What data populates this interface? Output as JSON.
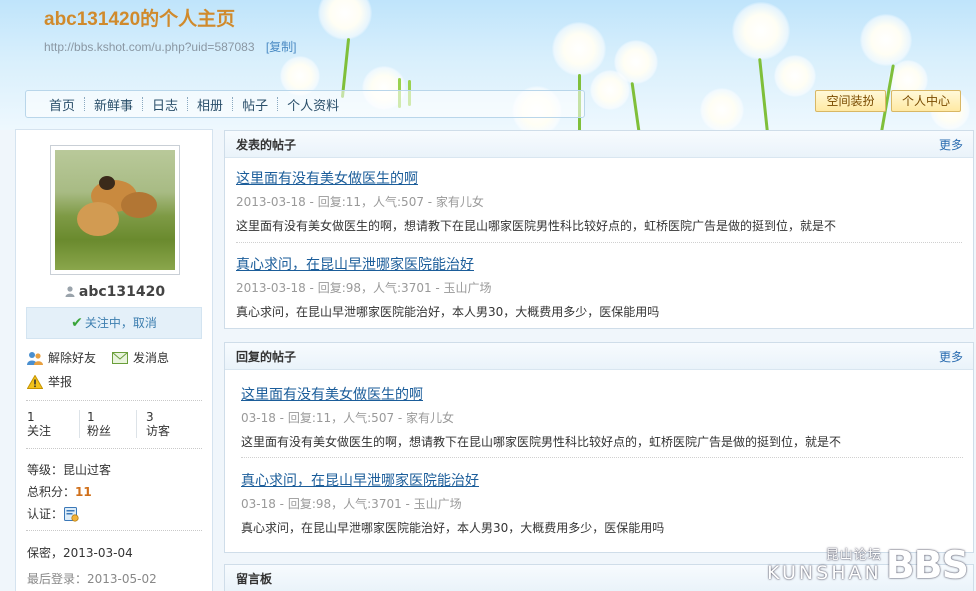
{
  "header": {
    "title": "abc131420的个人主页",
    "url": "http://bbs.kshot.com/u.php?uid=587083",
    "copy_label": "[复制]"
  },
  "nav": {
    "items": [
      {
        "label": "首页"
      },
      {
        "label": "新鲜事"
      },
      {
        "label": "日志"
      },
      {
        "label": "相册"
      },
      {
        "label": "帖子"
      },
      {
        "label": "个人资料"
      }
    ]
  },
  "header_buttons": {
    "decorate": "空间装扮",
    "user_center": "个人中心"
  },
  "profile": {
    "username": "abc131420",
    "follow_status": "关注中",
    "follow_sep": "，",
    "cancel": "取消",
    "actions": {
      "unfriend": "解除好友",
      "message": "发消息",
      "report": "举报"
    },
    "stats": [
      {
        "value": "1",
        "label": "关注"
      },
      {
        "value": "1",
        "label": "粉丝"
      },
      {
        "value": "3",
        "label": "访客"
      }
    ],
    "level_label": "等级：",
    "level_value": "昆山过客",
    "points_label": "总积分：",
    "points_value": "11",
    "verify_label": "认证：",
    "privacy": "保密，2013-03-04",
    "last_login": "最后登录：2013-05-02"
  },
  "posted": {
    "title": "发表的帖子",
    "more": "更多",
    "items": [
      {
        "title": "这里面有没有美女做医生的啊",
        "meta": "2013-03-18 - 回复:11，人气:507 - 家有儿女",
        "body": "这里面有没有美女做医生的啊，想请教下在昆山哪家医院男性科比较好点的，虹桥医院广告是做的挺到位，就是不"
      },
      {
        "title": "真心求问，在昆山早泄哪家医院能治好",
        "meta": "2013-03-18 - 回复:98，人气:3701 - 玉山广场",
        "body": "真心求问，在昆山早泄哪家医院能治好，本人男30，大概费用多少，医保能用吗"
      }
    ]
  },
  "replied": {
    "title": "回复的帖子",
    "more": "更多",
    "items": [
      {
        "title": "这里面有没有美女做医生的啊",
        "meta": "03-18 - 回复:11，人气:507 - 家有儿女",
        "body": "这里面有没有美女做医生的啊，想请教下在昆山哪家医院男性科比较好点的，虹桥医院广告是做的挺到位，就是不"
      },
      {
        "title": "真心求问，在昆山早泄哪家医院能治好",
        "meta": "03-18 - 回复:98，人气:3701 - 玉山广场",
        "body": "真心求问，在昆山早泄哪家医院能治好，本人男30，大概费用多少，医保能用吗"
      }
    ]
  },
  "guestbook": {
    "title": "留言板"
  },
  "watermark": {
    "cn": "昆山论坛",
    "en": "KUNSHAN",
    "bbs": "BBS"
  },
  "colors": {
    "title": "#d08a2c",
    "link": "#1b5d9a",
    "points": "#d0701b"
  }
}
